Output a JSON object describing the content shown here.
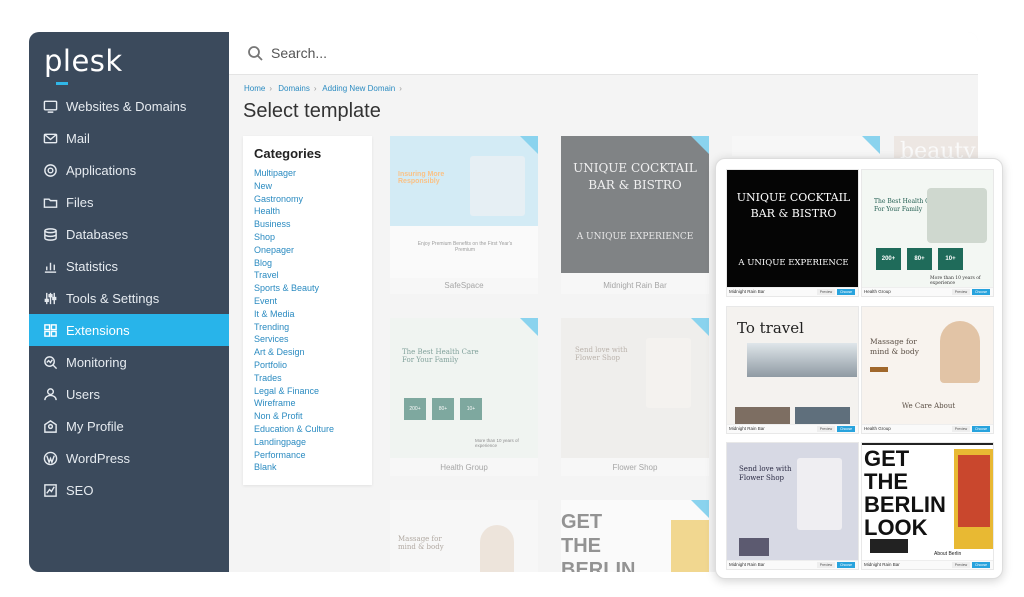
{
  "app": {
    "logo": "plesk"
  },
  "search": {
    "placeholder": "Search..."
  },
  "sidebar": {
    "items": [
      {
        "label": "Websites & Domains",
        "icon": "monitor-icon"
      },
      {
        "label": "Mail",
        "icon": "mail-icon"
      },
      {
        "label": "Applications",
        "icon": "gear-icon"
      },
      {
        "label": "Files",
        "icon": "folder-icon"
      },
      {
        "label": "Databases",
        "icon": "database-icon"
      },
      {
        "label": "Statistics",
        "icon": "bar-chart-icon"
      },
      {
        "label": "Tools & Settings",
        "icon": "sliders-icon"
      },
      {
        "label": "Extensions",
        "icon": "puzzle-icon",
        "active": true
      },
      {
        "label": "Monitoring",
        "icon": "monitoring-icon"
      },
      {
        "label": "Users",
        "icon": "user-icon"
      },
      {
        "label": "My Profile",
        "icon": "profile-icon"
      },
      {
        "label": "WordPress",
        "icon": "wordpress-icon"
      },
      {
        "label": "SEO",
        "icon": "seo-icon"
      }
    ]
  },
  "breadcrumb": [
    "Home",
    "Domains",
    "Adding New Domain"
  ],
  "page": {
    "title": "Select template"
  },
  "categories": {
    "heading": "Categories",
    "items": [
      "Multipager",
      "New",
      "Gastronomy",
      "Health",
      "Business",
      "Shop",
      "Onepager",
      "Blog",
      "Travel",
      "Sports & Beauty",
      "Event",
      "It & Media",
      "Trending",
      "Services",
      "Art & Design",
      "Portfolio",
      "Trades",
      "Legal & Finance",
      "Wireframe",
      "Non & Profit",
      "Education & Culture",
      "Landingpage",
      "Performance",
      "Blank"
    ]
  },
  "templates": {
    "safespace": {
      "name": "SafeSpace",
      "headline": "Insuring More Responsibly",
      "sub": "Enjoy Premium Benefits on the First Year's Premium"
    },
    "midnight": {
      "name": "Midnight Rain Bar",
      "headline": "UNIQUE COCKTAIL BAR & BISTRO",
      "sub": "A UNIQUE EXPERIENCE"
    },
    "beauty": {
      "name": "",
      "headline": "beauty"
    },
    "health": {
      "name": "Health Group",
      "headline": "The Best Health Care For Your Family",
      "stats": [
        "200+",
        "80+",
        "10+"
      ],
      "note": "More than 10 years of experience"
    },
    "flower": {
      "name": "Flower Shop",
      "headline": "Send love with Flower Shop"
    },
    "massage": {
      "name": "",
      "headline": "Massage for mind & body"
    },
    "berlin": {
      "name": "",
      "headline": "GET THE BERLIN"
    }
  },
  "tablet": {
    "cards": [
      {
        "name": "Midnight Rain Bar",
        "headline": "UNIQUE COCKTAIL BAR & BISTRO",
        "sub": "A UNIQUE EXPERIENCE"
      },
      {
        "name": "Health Group",
        "headline": "The Best Health Care For Your Family",
        "stats": [
          "200+",
          "80+",
          "10+"
        ],
        "note": "More than 10 years of experience"
      },
      {
        "name": "Midnight Rain Bar",
        "headline": "To travel"
      },
      {
        "name": "Health Group",
        "headline": "Massage for mind & body",
        "sub": "We Care About"
      },
      {
        "name": "Midnight Rain Bar",
        "headline": "Send love with Flower Shop"
      },
      {
        "name": "Midnight Rain Bar",
        "headline": "GET THE BERLIN LOOK",
        "sub": "About Berlin"
      }
    ],
    "preview_label": "Preview",
    "choose_label": "Choose"
  },
  "colors": {
    "sidebar": "#3b4a5c",
    "accent": "#28b4ea",
    "link": "#2b8bc1"
  }
}
